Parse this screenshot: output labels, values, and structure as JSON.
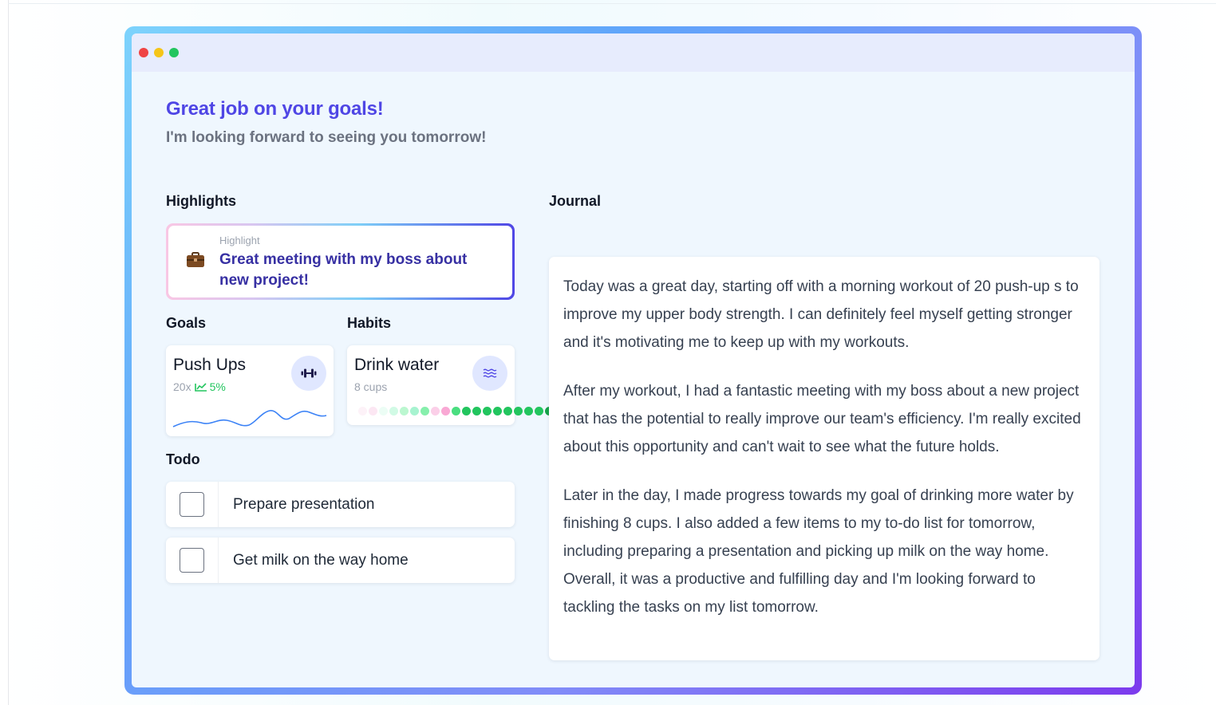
{
  "header": {
    "title": "Great job on your goals!",
    "subtitle": "I'm looking forward to seeing you tomorrow!"
  },
  "highlights": {
    "label": "Highlights",
    "card": {
      "small_label": "Highlight",
      "title": "Great meeting with my boss about new project!",
      "icon": "briefcase-icon"
    }
  },
  "goals": {
    "label": "Goals",
    "card": {
      "title": "Push Ups",
      "count": "20x",
      "trend": "5%",
      "icon": "dumbbell-icon",
      "trend_icon": "trending-up-icon"
    }
  },
  "habits": {
    "label": "Habits",
    "card": {
      "title": "Drink water",
      "subtitle": "8 cups",
      "icon": "water-waves-icon",
      "cup_colors": [
        "#fdf2f8",
        "#fce7f3",
        "#ecfdf5",
        "#d1fae5",
        "#bbf7d0",
        "#a7f3d0",
        "#86efac",
        "#fbcfe8",
        "#f9a8d4",
        "#4ade80",
        "#22c55e",
        "#22c55e",
        "#22c55e",
        "#22c55e",
        "#22c55e",
        "#22c55e",
        "#22c55e",
        "#22c55e",
        "#16a34a"
      ]
    }
  },
  "todo": {
    "label": "Todo",
    "items": [
      {
        "text": "Prepare presentation",
        "checked": false
      },
      {
        "text": "Get milk on the way home",
        "checked": false
      }
    ]
  },
  "journal": {
    "label": "Journal",
    "paragraphs": [
      "Today was a great day, starting off with a morning workout of 20 push-up s to improve my upper body strength. I can definitely feel myself getting stronger and it's motivating me to keep up with my workouts.",
      "After my workout, I had a fantastic meeting with my boss about a new project that has the potential to really improve our team's efficiency. I'm really excited about this opportunity and can't wait to see what the future holds.",
      "Later in the day, I made progress towards my goal of drinking more water by finishing 8 cups. I also added a few items to my to-do list for tomorrow, including preparing a presentation and picking up milk on the way home. Overall, it was a productive and fulfilling day and I'm looking forward to tackling the tasks on my list tomorrow."
    ]
  },
  "colors": {
    "accent": "#4f46e5",
    "highlight_title": "#3730a3",
    "trend_green": "#22c55e",
    "sparkline": "#3b82f6"
  }
}
